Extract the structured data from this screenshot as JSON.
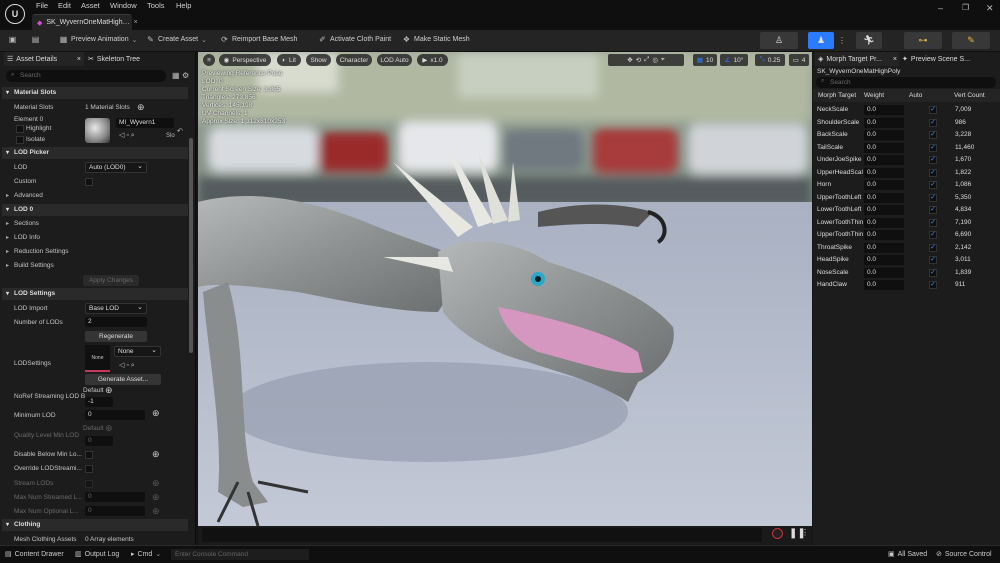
{
  "menubar": {
    "items": [
      "File",
      "Edit",
      "Asset",
      "Window",
      "Tools",
      "Help"
    ]
  },
  "doc_tab": {
    "label": "SK_WyvernOneMatHigh…"
  },
  "toolbar": {
    "preview_animation": "Preview Animation",
    "create_asset": "Create Asset",
    "reimport": "Reimport Base Mesh",
    "cloth_paint": "Activate Cloth Paint",
    "make_static": "Make Static Mesh"
  },
  "left_panel": {
    "tabs": [
      "Asset Details",
      "Skeleton Tree"
    ],
    "search_placeholder": "Search",
    "material_slots": {
      "header": "Material Slots",
      "label": "Material Slots",
      "count": "1 Material Slots",
      "element": "Element 0",
      "material_name": "MI_Wyvern1",
      "highlight": "Highlight",
      "isolate": "Isolate",
      "sk": "Slo"
    },
    "lod_picker": {
      "header": "LOD Picker",
      "lod_label": "LOD",
      "lod_value": "Auto (LOD0)",
      "custom": "Custom",
      "advanced": "Advanced"
    },
    "lod0": {
      "header": "LOD 0",
      "items": [
        "Sections",
        "LOD Info",
        "Reduction Settings",
        "Build Settings"
      ],
      "apply": "Apply Changes"
    },
    "lod_settings": {
      "header": "LOD Settings",
      "lod_import": "LOD Import",
      "lod_import_value": "Base LOD",
      "num_lods": "Number of LODs",
      "num_lods_value": "2",
      "regenerate": "Regenerate",
      "lod_settings": "LODSettings",
      "none_thumb": "None",
      "none_dropdown": "None",
      "generate": "Generate Asset...",
      "noref": "NoRef Streaming LOD B",
      "default1": "Default",
      "noref_value": "-1",
      "min_lod": "Minimum LOD",
      "min_lod_value": "0",
      "default2": "Default",
      "quality_min": "Quality Level Min LOD",
      "quality_min_value": "0",
      "disable_below": "Disable Below Min Lo...",
      "override_streaming": "Override LODStreami...",
      "stream_lods": "Stream LODs",
      "max_streamed": "Max Num Streamed L...",
      "max_streamed_value": "0",
      "max_optional": "Max Num Optional L...",
      "max_optional_value": "0"
    },
    "clothing": {
      "header": "Clothing",
      "assets": "Mesh Clothing Assets",
      "assets_value": "0 Array elements"
    }
  },
  "viewport": {
    "buttons": [
      "Perspective",
      "Lit",
      "Show",
      "Character",
      "LOD Auto",
      "x1.0"
    ],
    "right_buttons": [
      "10",
      "10°",
      "0.25",
      "4"
    ],
    "hud": [
      "Previewing Reference Pose",
      "LOD: 0",
      "Current Screen Size: 3.865",
      "Triangles: 273,856",
      "Vertices: 145,198",
      "UV Channels: 1",
      "Approx Size: 1,312x810x253"
    ]
  },
  "right_panel": {
    "tabs": [
      "Morph Target Pr...",
      "Preview Scene S..."
    ],
    "mesh_name": "SK_WyvernOneMatHighPoly",
    "search_placeholder": "Search",
    "columns": [
      "Morph Target",
      "Weight",
      "Auto",
      "Vert Count"
    ],
    "rows": [
      {
        "name": "NeckScale",
        "weight": "0.0",
        "vc": "7,009"
      },
      {
        "name": "ShoulderScale",
        "weight": "0.0",
        "vc": "986"
      },
      {
        "name": "BackScale",
        "weight": "0.0",
        "vc": "3,228"
      },
      {
        "name": "TailScale",
        "weight": "0.0",
        "vc": "11,460"
      },
      {
        "name": "UnderJoeSpike",
        "weight": "0.0",
        "vc": "1,670"
      },
      {
        "name": "UpperHeadScale",
        "weight": "0.0",
        "vc": "1,822"
      },
      {
        "name": "Horn",
        "weight": "0.0",
        "vc": "1,086"
      },
      {
        "name": "UpperToothLeft",
        "weight": "0.0",
        "vc": "5,350"
      },
      {
        "name": "LowerToothLeft",
        "weight": "0.0",
        "vc": "4,834"
      },
      {
        "name": "LowerToothThin",
        "weight": "0.0",
        "vc": "7,190"
      },
      {
        "name": "UpperToothThin",
        "weight": "0.0",
        "vc": "6,690"
      },
      {
        "name": "ThroatSpike",
        "weight": "0.0",
        "vc": "2,142"
      },
      {
        "name": "HeadSpike",
        "weight": "0.0",
        "vc": "3,011"
      },
      {
        "name": "NoseScale",
        "weight": "0.0",
        "vc": "1,839"
      },
      {
        "name": "HandClaw",
        "weight": "0.0",
        "vc": "911"
      }
    ]
  },
  "statusbar": {
    "content_drawer": "Content Drawer",
    "output_log": "Output Log",
    "cmd": "Cmd",
    "console_placeholder": "Enter Console Command",
    "all_saved": "All Saved",
    "source_control": "Source Control"
  },
  "colors": {
    "accent": "#2a7bff",
    "bg_panel": "#1c1c1c",
    "checkbox": "#3d8bff"
  }
}
